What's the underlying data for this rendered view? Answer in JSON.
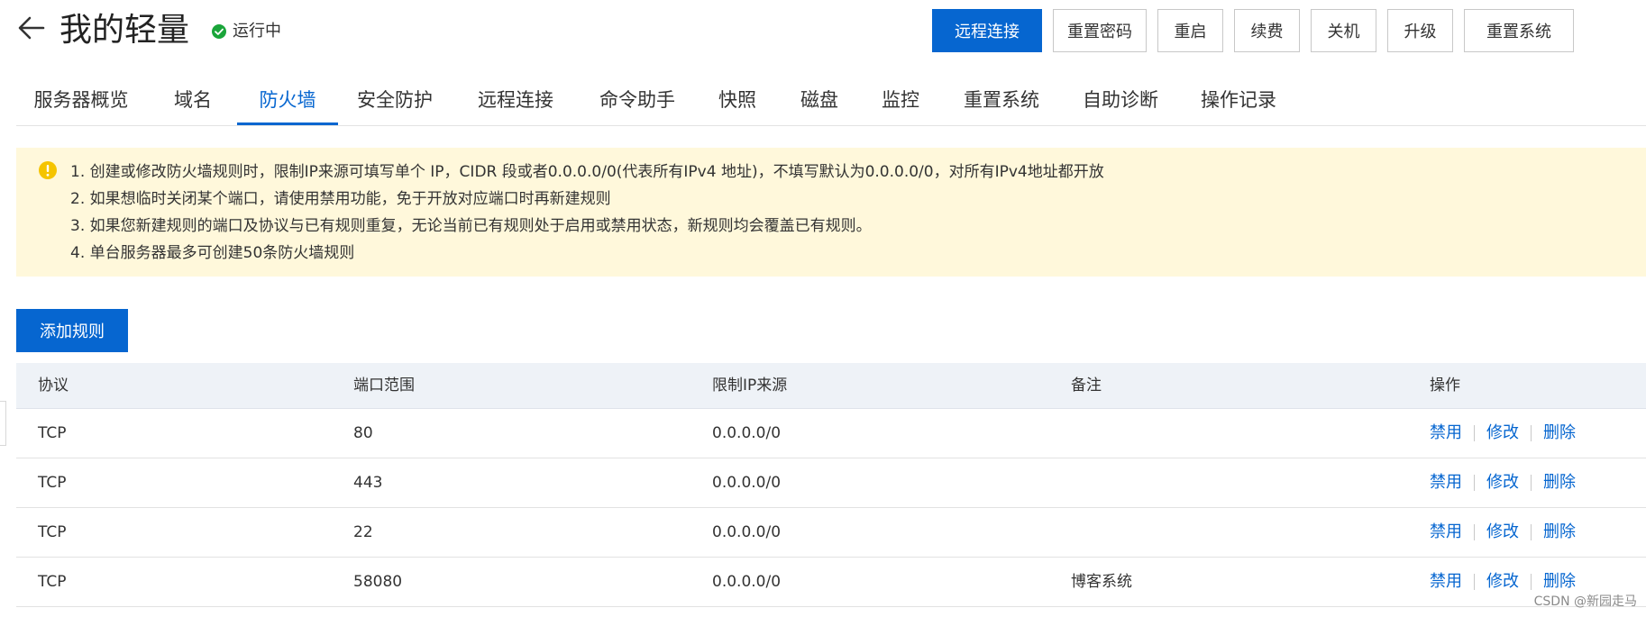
{
  "header": {
    "title": "我的轻量",
    "status": "运行中",
    "actions": [
      "远程连接",
      "重置密码",
      "重启",
      "续费",
      "关机",
      "升级",
      "重置系统"
    ]
  },
  "tabs": [
    "服务器概览",
    "域名",
    "防火墙",
    "安全防护",
    "远程连接",
    "命令助手",
    "快照",
    "磁盘",
    "监控",
    "重置系统",
    "自助诊断",
    "操作记录"
  ],
  "active_tab": "防火墙",
  "notice": {
    "lines": [
      "1. 创建或修改防火墙规则时，限制IP来源可填写单个 IP，CIDR 段或者0.0.0.0/0(代表所有IPv4 地址)，不填写默认为0.0.0.0/0，对所有IPv4地址都开放",
      "2. 如果想临时关闭某个端口，请使用禁用功能，免于开放对应端口时再新建规则",
      "3. 如果您新建规则的端口及协议与已有规则重复，无论当前已有规则处于启用或禁用状态，新规则均会覆盖已有规则。",
      "4. 单台服务器最多可创建50条防火墙规则"
    ]
  },
  "add_rule_label": "添加规则",
  "table": {
    "headers": [
      "协议",
      "端口范围",
      "限制IP来源",
      "备注",
      "操作"
    ],
    "rows": [
      {
        "protocol": "TCP",
        "port": "80",
        "source": "0.0.0.0/0",
        "note": ""
      },
      {
        "protocol": "TCP",
        "port": "443",
        "source": "0.0.0.0/0",
        "note": ""
      },
      {
        "protocol": "TCP",
        "port": "22",
        "source": "0.0.0.0/0",
        "note": ""
      },
      {
        "protocol": "TCP",
        "port": "58080",
        "source": "0.0.0.0/0",
        "note": "博客系统"
      }
    ],
    "row_actions": [
      "禁用",
      "修改",
      "删除"
    ]
  },
  "watermark": "CSDN @新园走马",
  "colors": {
    "primary": "#0666d0",
    "notice_bg": "#fff8db",
    "status_green": "#1aa53a",
    "notice_icon": "#f5c400"
  }
}
